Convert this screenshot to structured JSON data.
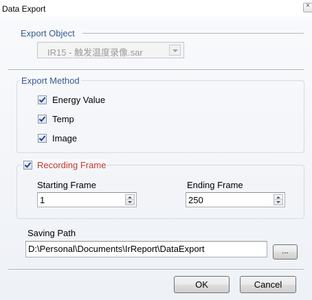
{
  "window": {
    "title": "Data Export",
    "close_glyph": "×"
  },
  "export_object": {
    "legend": "Export Object",
    "file_selected": "IR15 - 触发温度录像.sar"
  },
  "export_method": {
    "legend": "Export Method",
    "options": [
      {
        "label": "Energy Value",
        "checked": true
      },
      {
        "label": "Temp",
        "checked": true
      },
      {
        "label": "Image",
        "checked": true
      }
    ]
  },
  "recording_frame": {
    "legend": "Recording Frame",
    "checked": true,
    "starting_label": "Starting Frame",
    "starting_value": "1",
    "ending_label": "Ending Frame",
    "ending_value": "250"
  },
  "saving": {
    "label": "Saving Path",
    "path": "D:\\Personal\\Documents\\IrReport\\DataExport",
    "browse_label": "..."
  },
  "buttons": {
    "ok": "OK",
    "cancel": "Cancel"
  },
  "colors": {
    "section_label": "#3a5a8c",
    "recording_label": "#c0392b",
    "disabled_text": "#9a9a9a"
  }
}
